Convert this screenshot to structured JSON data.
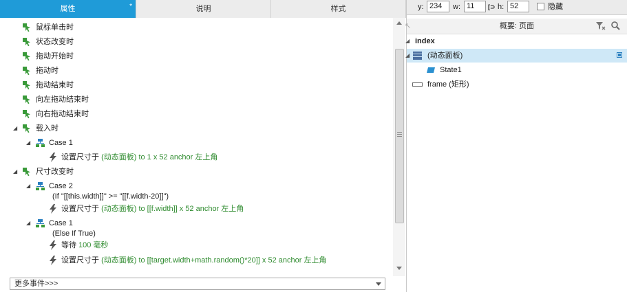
{
  "tabs": [
    {
      "label": "属性",
      "star": "*"
    },
    {
      "label": "说明"
    },
    {
      "label": "样式"
    }
  ],
  "events": [
    {
      "label": "鼠标单击时"
    },
    {
      "label": "状态改变时"
    },
    {
      "label": "拖动开始时"
    },
    {
      "label": "拖动时"
    },
    {
      "label": "拖动结束时"
    },
    {
      "label": "向左拖动结束时"
    },
    {
      "label": "向右拖动结束时"
    }
  ],
  "onload": {
    "label": "载入时",
    "case_label": "Case 1",
    "action": {
      "prefix": "设置尺寸于 ",
      "target": "(动态面板)",
      "rest": " to 1 x 52 anchor ",
      "anchor": "左上角"
    }
  },
  "onresize": {
    "label": "尺寸改变时",
    "case2": {
      "label": "Case 2",
      "condition": "(If \"[[this.width]]\" >= \"[[f.width-20]]\")",
      "action": {
        "prefix": "设置尺寸于 ",
        "target": "(动态面板)",
        "rest": " to [[f.width]] x 52 anchor ",
        "anchor": "左上角"
      }
    },
    "case1": {
      "label": "Case 1",
      "condition": "(Else If True)",
      "wait": {
        "prefix": "等待 ",
        "value": "100 毫秒"
      },
      "action": {
        "prefix": "设置尺寸于 ",
        "target": "(动态面板)",
        "rest": " to [[target.width+math.random()*20]] x 52 anchor ",
        "anchor": "左上角"
      }
    }
  },
  "more_events": "更多事件>>>",
  "props": {
    "y_label": "y:",
    "y_value": "234",
    "w_label": "w:",
    "w_value": "11",
    "h_label": "h:",
    "h_value": "52",
    "hidden_label": "隐藏"
  },
  "outline": {
    "title": "概要: 页面",
    "page": "index",
    "items": [
      {
        "label": "(动态面板)"
      },
      {
        "label": "State1"
      },
      {
        "label": "frame (矩形)"
      }
    ]
  },
  "colors": {
    "accent": "#1f9bd8",
    "green_text": "#2e8b2e",
    "event_icon": "#3a9a3a",
    "case_icon": "#2a7fc0"
  }
}
